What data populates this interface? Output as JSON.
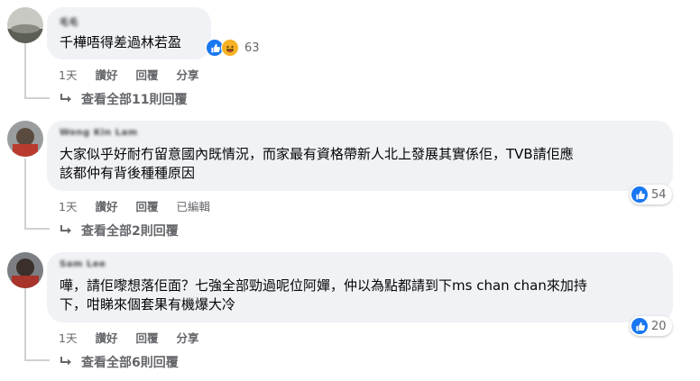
{
  "comments": [
    {
      "author": "毛毛",
      "text_lines": [
        "千樺唔得差過林若盈"
      ],
      "reaction_count": "63",
      "reaction_icons": [
        "like-icon",
        "haha-icon"
      ],
      "actions": {
        "time": "1天",
        "like": "讚好",
        "reply": "回覆",
        "share": "分享",
        "edited": ""
      },
      "view_replies": "查看全部11則回覆"
    },
    {
      "author": "Wong Kin Lam",
      "text_lines": [
        "大家似乎好耐冇留意國內既情況，而家最有資格帶新人北上發展其實係佢，TVB請佢應",
        "該都仲有背後種種原因"
      ],
      "reaction_count": "54",
      "reaction_icons": [
        "like-icon"
      ],
      "actions": {
        "time": "1天",
        "like": "讚好",
        "reply": "回覆",
        "share": "",
        "edited": "已編輯"
      },
      "view_replies": "查看全部2則回覆"
    },
    {
      "author": "Sam Lee",
      "text_lines": [
        "嘩，請佢嚟想落佢面？七強全部勁過呢位阿嬋，仲以為點都請到下ms chan chan來加持",
        "下，咁睇來個套果有機爆大冷"
      ],
      "reaction_count": "20",
      "reaction_icons": [
        "like-icon"
      ],
      "actions": {
        "time": "1天",
        "like": "讚好",
        "reply": "回覆",
        "share": "分享",
        "edited": ""
      },
      "view_replies": "查看全部6則回覆"
    }
  ],
  "colors": {
    "bubble": "#f0f2f5",
    "like_blue": "#1877f2",
    "haha_yellow": "#f7b125",
    "meta_gray": "#65676b"
  }
}
